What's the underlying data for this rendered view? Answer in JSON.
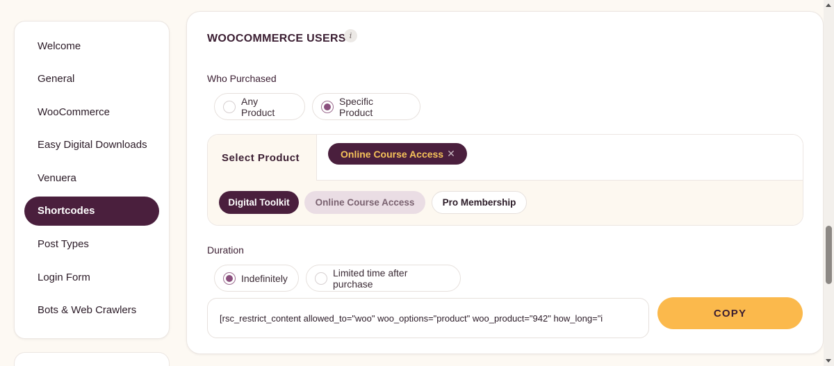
{
  "sidebar": {
    "items": [
      {
        "label": "Welcome",
        "active": false
      },
      {
        "label": "General",
        "active": false
      },
      {
        "label": "WooCommerce",
        "active": false
      },
      {
        "label": "Easy Digital Downloads",
        "active": false
      },
      {
        "label": "Venuera",
        "active": false
      },
      {
        "label": "Shortcodes",
        "active": true
      },
      {
        "label": "Post Types",
        "active": false
      },
      {
        "label": "Login Form",
        "active": false
      },
      {
        "label": "Bots & Web Crawlers",
        "active": false
      }
    ]
  },
  "section": {
    "title": "WOOCOMMERCE USERS",
    "info_icon": "i"
  },
  "who_purchased": {
    "label": "Who Purchased",
    "options": [
      "Any Product",
      "Specific Product"
    ],
    "selected": "Specific Product"
  },
  "product_select": {
    "label": "Select Product",
    "selected_chip": "Online Course Access",
    "remove_glyph": "✕",
    "options": [
      "Digital Toolkit",
      "Online Course Access",
      "Pro Membership"
    ]
  },
  "duration": {
    "label": "Duration",
    "options": [
      "Indefinitely",
      "Limited time after purchase"
    ],
    "selected": "Indefinitely"
  },
  "shortcode": {
    "value": "[rsc_restrict_content allowed_to=\"woo\" woo_options=\"product\" woo_product=\"942\" how_long=\"i"
  },
  "copy_button": {
    "label": "COPY"
  },
  "colors": {
    "brand_dark": "#4a1f3d",
    "accent_yellow": "#fbb94c",
    "chip_text": "#f6c35a",
    "page_bg": "#fdf9f3"
  }
}
